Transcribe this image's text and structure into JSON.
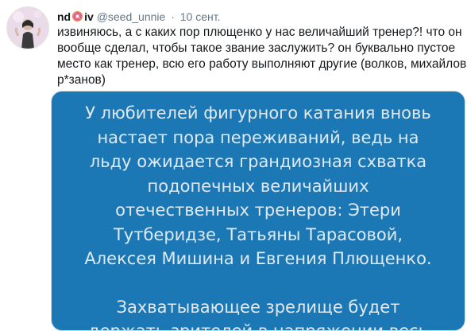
{
  "tweet": {
    "author_name_prefix": "nd",
    "author_name_suffix": "iv",
    "handle": "@seed_unnie",
    "separator": "·",
    "date": "10 сент.",
    "text_lines": [
      "извиняюсь, а с каких пор плющенко у нас величайший тренер?! что он",
      "вообще сделал, чтобы такое звание заслужить? он буквально пустое",
      "место как тренер, всю его работу выполняют другие (волков, михайлов,",
      "р*занов)"
    ],
    "image_text_lines": [
      "У любителей фигурного катания вновь",
      "настает пора переживаний, ведь на",
      "льду ожидается грандиозная схватка",
      "подопечных величайших",
      "отечественных тренеров: Этери",
      "Тутберидзе, Татьяны Тарасовой,",
      "Алексея Мишина и Евгения Плющенко."
    ],
    "image_text_lines_2": [
      "Захватывающее зрелище будет",
      "держать зрителей в напряжении весь"
    ]
  },
  "icons": {
    "avatar": "avatar-photo",
    "name_emoji": "donut-emoji"
  },
  "colors": {
    "image_background": "#1c78b5",
    "secondary_text": "#657786"
  }
}
